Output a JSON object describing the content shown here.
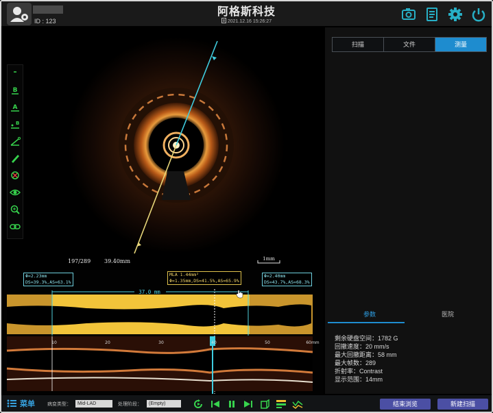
{
  "header": {
    "title": "阿格斯科技",
    "id_label": "ID : 123",
    "datetime": "2021.12.16 15:26:27",
    "icons": [
      "user-icon",
      "camera-icon",
      "report-icon",
      "gear-icon",
      "power-icon"
    ]
  },
  "image": {
    "frame_info": "197/289",
    "length": "39.40mm",
    "scale_label": "1mm"
  },
  "tools": [
    "minus-icon",
    "point-b-icon",
    "point-a-icon",
    "ab-icon",
    "angle-icon",
    "pen-icon",
    "delete-icon",
    "eye-icon",
    "zoom-icon",
    "link-icon"
  ],
  "tabs": [
    {
      "label": "扫描",
      "active": false
    },
    {
      "label": "文件",
      "active": false
    },
    {
      "label": "测量",
      "active": true
    }
  ],
  "sub_tabs": [
    {
      "label": "参数",
      "active": true
    },
    {
      "label": "医院",
      "active": false
    }
  ],
  "params": [
    "剩余硬盘空间：1782 G",
    "回撤速度：20 mm/s",
    "最大回撤距离：58 mm",
    "最大帧数：289",
    "折射率：Contrast",
    "显示范围：14mm"
  ],
  "measurements": {
    "left": {
      "line1": "Φ=2.23mm",
      "line2": "DS=39.3%,AS=63.1%"
    },
    "mla": {
      "line1": "MLA 1.44mm²",
      "line2": "Φ=1.35mm,DS=41.5%,AS=65.9%"
    },
    "right": {
      "line1": "Φ=2.40mm",
      "line2": "DS=43.7%,AS=68.3%"
    },
    "segment_length": "37.0 mm"
  },
  "ruler_ticks": [
    "10",
    "20",
    "30",
    "40",
    "50",
    "60mm"
  ],
  "bottom": {
    "menu_label": "菜单",
    "lesion_type_label": "病变类型：",
    "lesion_type_value": "Mid-LAD",
    "stage_label": "处理阶段：",
    "stage_value": "(Empty)",
    "end_button": "结束浏览",
    "new_scan_button": "新建扫描"
  },
  "colors": {
    "accent": "#1e8ccf",
    "cyan": "#6fd1e0",
    "yellow": "#f2c43a",
    "button": "#4b4fa4"
  }
}
